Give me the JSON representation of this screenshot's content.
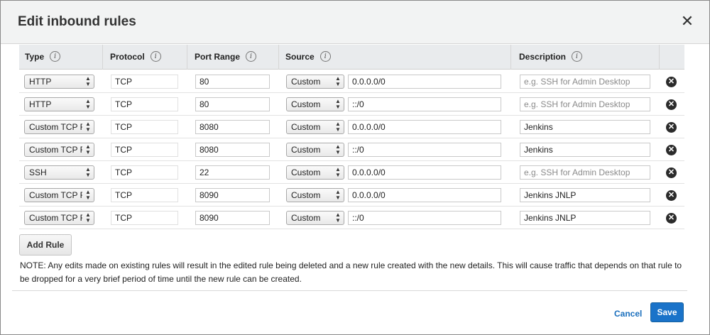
{
  "dialog": {
    "title": "Edit inbound rules",
    "close_glyph": "✕"
  },
  "columns": [
    {
      "label": "Type",
      "info": "i"
    },
    {
      "label": "Protocol",
      "info": "i"
    },
    {
      "label": "Port Range",
      "info": "i"
    },
    {
      "label": "Source",
      "info": "i"
    },
    {
      "label": "Description",
      "info": "i"
    }
  ],
  "rows": [
    {
      "type": "HTTP",
      "protocol": "TCP",
      "port": "80",
      "source_type": "Custom",
      "source": "0.0.0.0/0",
      "description": "",
      "description_placeholder": "e.g. SSH for Admin Desktop"
    },
    {
      "type": "HTTP",
      "protocol": "TCP",
      "port": "80",
      "source_type": "Custom",
      "source": "::/0",
      "description": "",
      "description_placeholder": "e.g. SSH for Admin Desktop"
    },
    {
      "type": "Custom TCP Rule",
      "protocol": "TCP",
      "port": "8080",
      "source_type": "Custom",
      "source": "0.0.0.0/0",
      "description": "Jenkins",
      "description_placeholder": "e.g. SSH for Admin Desktop"
    },
    {
      "type": "Custom TCP Rule",
      "protocol": "TCP",
      "port": "8080",
      "source_type": "Custom",
      "source": "::/0",
      "description": "Jenkins",
      "description_placeholder": "e.g. SSH for Admin Desktop"
    },
    {
      "type": "SSH",
      "protocol": "TCP",
      "port": "22",
      "source_type": "Custom",
      "source": "0.0.0.0/0",
      "description": "",
      "description_placeholder": "e.g. SSH for Admin Desktop"
    },
    {
      "type": "Custom TCP Rule",
      "protocol": "TCP",
      "port": "8090",
      "source_type": "Custom",
      "source": "0.0.0.0/0",
      "description": "Jenkins JNLP",
      "description_placeholder": "e.g. SSH for Admin Desktop"
    },
    {
      "type": "Custom TCP Rule",
      "protocol": "TCP",
      "port": "8090",
      "source_type": "Custom",
      "source": "::/0",
      "description": "Jenkins JNLP",
      "description_placeholder": "e.g. SSH for Admin Desktop"
    }
  ],
  "add_rule_label": "Add Rule",
  "note": "NOTE: Any edits made on existing rules will result in the edited rule being deleted and a new rule created with the new details. This will cause traffic that depends on that rule to be dropped for a very brief period of time until the new rule can be created.",
  "footer": {
    "cancel_label": "Cancel",
    "save_label": "Save"
  },
  "colors": {
    "accent": "#1a73c9",
    "link": "#1a6fbd",
    "header_bg": "#f2f3f3",
    "table_header_bg": "#e9ebed"
  },
  "icons": {
    "close": "close-icon",
    "info": "info-icon",
    "delete": "remove-circle-icon",
    "select": "up-down-chevron-icon"
  }
}
